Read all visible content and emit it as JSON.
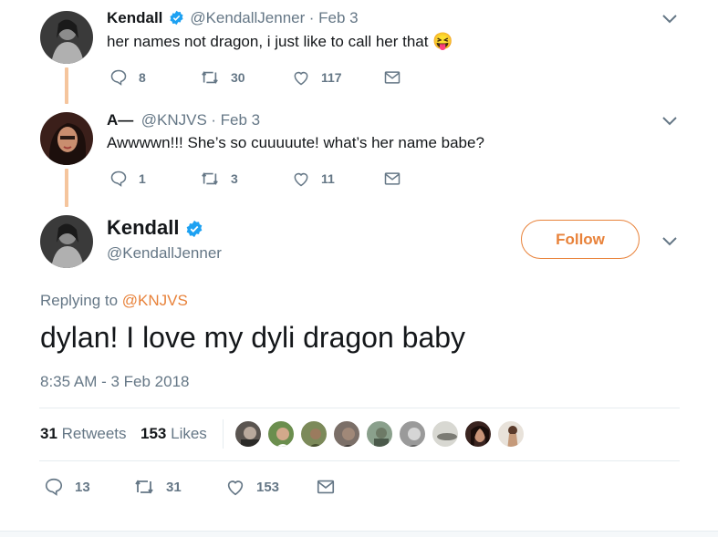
{
  "reply1": {
    "name": "Kendall",
    "handle": "@KendallJenner",
    "date": "· Feb 3",
    "text": "her names not dragon, i just like to call her that",
    "emoji": "😝",
    "replies": "8",
    "retweets": "30",
    "likes": "117"
  },
  "reply2": {
    "name": "A—",
    "handle": "@KNJVS",
    "date": "· Feb 3",
    "text": "Awwwwn!!! She’s so cuuuuute! what’s her name babe?",
    "replies": "1",
    "retweets": "3",
    "likes": "11"
  },
  "main": {
    "name": "Kendall",
    "handle": "@KendallJenner",
    "follow_label": "Follow",
    "replying_prefix": "Replying to",
    "replying_handle": "@KNJVS",
    "text": "dylan! I love my dyli dragon baby",
    "timestamp": "8:35 AM - 3 Feb 2018",
    "retweets_count": "31",
    "retweets_label": "Retweets",
    "likes_count": "153",
    "likes_label": "Likes",
    "replies": "13",
    "retweets": "31",
    "likes": "153"
  },
  "colors": {
    "accent": "#e8823a",
    "verified": "#1da1f2",
    "thread_line": "#f5c59d",
    "muted": "#657786"
  },
  "icons": [
    "verified-badge-icon",
    "chevron-down-icon",
    "reply-icon",
    "retweet-icon",
    "like-icon",
    "message-icon"
  ]
}
